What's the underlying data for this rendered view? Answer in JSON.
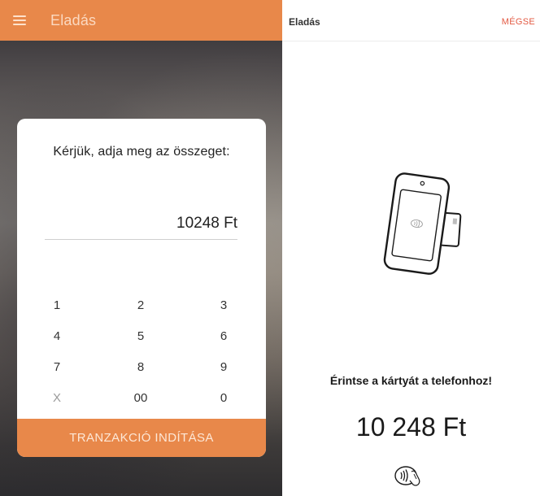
{
  "left_screen": {
    "topbar": {
      "menu_icon": "hamburger-menu-icon",
      "title": "Eladás"
    },
    "dialog": {
      "prompt": "Kérjük, adja meg az összeget:",
      "amount": "10248 Ft",
      "keypad": [
        [
          "1",
          "2",
          "3"
        ],
        [
          "4",
          "5",
          "6"
        ],
        [
          "7",
          "8",
          "9"
        ],
        [
          "X",
          "00",
          "0"
        ]
      ],
      "start_button": "TRANZAKCIÓ INDÍTÁSA"
    },
    "accent_color": "#e8884a"
  },
  "right_screen": {
    "header": {
      "title": "Eladás",
      "cancel": "MÉGSE"
    },
    "illustration_icon": "phone-tap-card-icon",
    "instruction": "Érintse a kártyát a telefonhoz!",
    "amount": "10 248 Ft",
    "contactless_icon": "contactless-payment-icon",
    "cancel_color": "#e35a43"
  }
}
